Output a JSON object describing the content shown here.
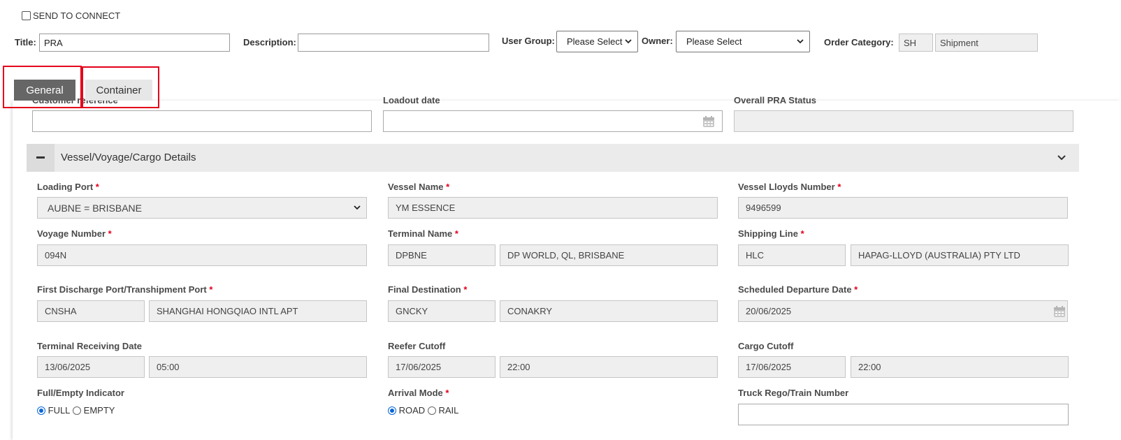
{
  "header": {
    "send_to_connect": "SEND TO CONNECT",
    "title_label": "Title:",
    "title_value": "PRA",
    "description_label": "Description:",
    "description_value": "",
    "user_group_label": "User Group:",
    "user_group_value": "Please Select",
    "owner_label": "Owner:",
    "owner_value": "Please Select",
    "order_category_label": "Order Category:",
    "order_category_code": "SH",
    "order_category_name": "Shipment"
  },
  "tabs": {
    "general": "General",
    "container": "Container"
  },
  "top_fields": {
    "customer_reference_label": "Customer reference",
    "loadout_date_label": "Loadout date",
    "overall_status_label": "Overall PRA Status"
  },
  "section": {
    "title": "Vessel/Voyage/Cargo Details"
  },
  "required_mark": "*",
  "fields": {
    "loading_port": {
      "label": "Loading Port",
      "value": "AUBNE = BRISBANE"
    },
    "vessel_name": {
      "label": "Vessel Name",
      "value": "YM ESSENCE"
    },
    "vessel_lloyds": {
      "label": "Vessel Lloyds Number",
      "value": "9496599"
    },
    "voyage_number": {
      "label": "Voyage Number",
      "value": "094N"
    },
    "terminal_name": {
      "label": "Terminal Name",
      "code": "DPBNE",
      "name": "DP WORLD, QL, BRISBANE"
    },
    "shipping_line": {
      "label": "Shipping Line",
      "code": "HLC",
      "name": "HAPAG-LLOYD (AUSTRALIA) PTY LTD"
    },
    "first_discharge": {
      "label": "First Discharge Port/Transhipment Port",
      "code": "CNSHA",
      "name": "SHANGHAI HONGQIAO INTL APT"
    },
    "final_destination": {
      "label": "Final Destination",
      "code": "GNCKY",
      "name": "CONAKRY"
    },
    "scheduled_departure": {
      "label": "Scheduled Departure Date",
      "value": "20/06/2025"
    },
    "terminal_receiving": {
      "label": "Terminal Receiving Date",
      "date": "13/06/2025",
      "time": "05:00"
    },
    "reefer_cutoff": {
      "label": "Reefer Cutoff",
      "date": "17/06/2025",
      "time": "22:00"
    },
    "cargo_cutoff": {
      "label": "Cargo Cutoff",
      "date": "17/06/2025",
      "time": "22:00"
    },
    "full_empty": {
      "label": "Full/Empty Indicator",
      "opt1": "FULL",
      "opt2": "EMPTY",
      "selected": "FULL"
    },
    "arrival_mode": {
      "label": "Arrival Mode",
      "opt1": "ROAD",
      "opt2": "RAIL",
      "selected": "ROAD"
    },
    "truck_rego": {
      "label": "Truck Rego/Train Number",
      "value": ""
    }
  },
  "colors": {
    "required": "#e4001b",
    "active_tab": "#666666",
    "radio_selected": "#0a66d8"
  }
}
